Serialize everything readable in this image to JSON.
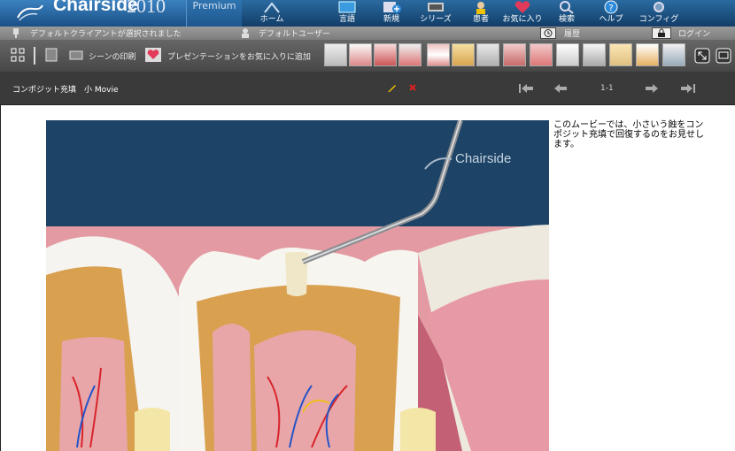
{
  "app": {
    "name": "Chairside",
    "year": "2010",
    "edition": "Premium",
    "watermark": "Chairside"
  },
  "nav": {
    "items": [
      {
        "label": "ホーム",
        "icon": "home-icon"
      },
      {
        "label": "言語",
        "icon": "language-icon"
      },
      {
        "label": "新規",
        "icon": "new-icon"
      },
      {
        "label": "シリーズ",
        "icon": "series-icon"
      },
      {
        "label": "患者",
        "icon": "patient-icon"
      },
      {
        "label": "お気に入り",
        "icon": "favorites-icon"
      },
      {
        "label": "検索",
        "icon": "search-icon"
      },
      {
        "label": "ヘルプ",
        "icon": "help-icon"
      },
      {
        "label": "コンフィグ",
        "icon": "config-icon"
      }
    ]
  },
  "infobar": {
    "client": "デフォルトクライアントが選択されました",
    "user": "デフォルトユーザー",
    "history": "履歴",
    "login": "ログイン"
  },
  "toolbar": {
    "print_scene": "シーンの印刷",
    "add_favorite": "プレゼンテーションをお気に入りに追加"
  },
  "movie": {
    "title": "コンポジット充填　小  Movie",
    "counter": "1-1"
  },
  "description": "このムービーでは、小さいう蝕をコンポジット充填で回復するのをお見せします。",
  "colors": {
    "nav_blue": "#1a4f86",
    "toolbar_gray": "#474747",
    "delete_red": "#e02020",
    "edit_yellow": "#f2c200"
  }
}
